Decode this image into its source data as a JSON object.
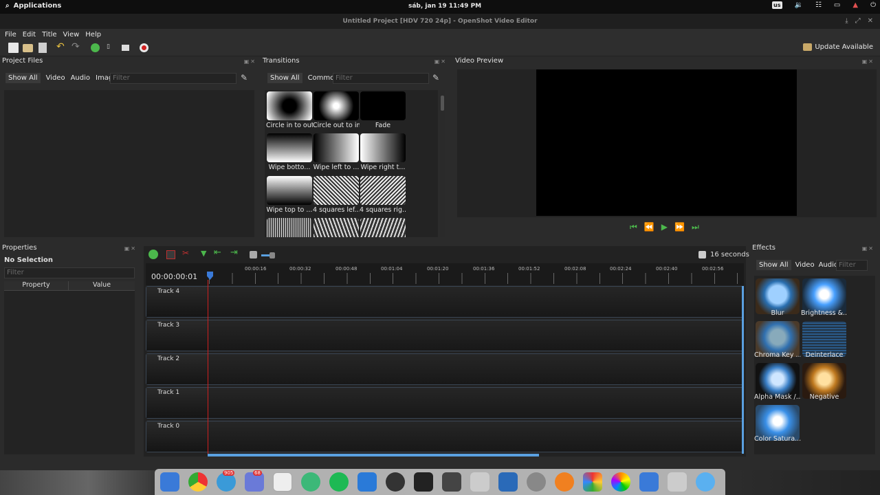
{
  "system_bar": {
    "applications": "Applications",
    "clock": "sáb, jan 19     11:49 PM",
    "keyboard": "us"
  },
  "window": {
    "title": "Untitled Project [HDV 720 24p] - OpenShot Video Editor"
  },
  "menu": {
    "file": "File",
    "edit": "Edit",
    "title": "Title",
    "view": "View",
    "help": "Help"
  },
  "toolbar": {
    "update_label": "Update Available"
  },
  "project_files": {
    "header": "Project Files",
    "tabs": [
      "Show All",
      "Video",
      "Audio",
      "Image"
    ],
    "filter_placeholder": "Filter"
  },
  "transitions": {
    "header": "Transitions",
    "tabs": [
      "Show All",
      "Common"
    ],
    "filter_placeholder": "Filter",
    "items": [
      "Circle in to out",
      "Circle out to in",
      "Fade",
      "Wipe botto...",
      "Wipe left to ...",
      "Wipe right t...",
      "Wipe top to ...",
      "4 squares lef...",
      "4 squares rig..."
    ]
  },
  "video_preview": {
    "header": "Video Preview"
  },
  "properties": {
    "header": "Properties",
    "selection": "No Selection",
    "filter_placeholder": "Filter",
    "col_property": "Property",
    "col_value": "Value"
  },
  "timeline": {
    "zoom_label": "16 seconds",
    "timecode": "00:00:00:01",
    "ticks": [
      "00:00:16",
      "00:00:32",
      "00:00:48",
      "00:01:04",
      "00:01:20",
      "00:01:36",
      "00:01:52",
      "00:02:08",
      "00:02:24",
      "00:02:40",
      "00:02:56"
    ],
    "tracks": [
      "Track 4",
      "Track 3",
      "Track 2",
      "Track 1",
      "Track 0"
    ]
  },
  "effects": {
    "header": "Effects",
    "tabs": [
      "Show All",
      "Video",
      "Audio"
    ],
    "filter_placeholder": "Filter",
    "items": [
      "Blur",
      "Brightness &...",
      "Chroma Key ...",
      "Deinterlace",
      "Alpha Mask /...",
      "Negative",
      "Color Satura..."
    ]
  },
  "dock": {
    "badge_telegram": "905",
    "badge_discord": "68"
  }
}
